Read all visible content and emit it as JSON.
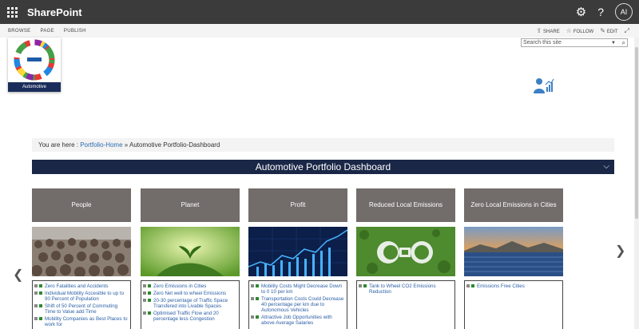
{
  "suitebar": {
    "brand": "SharePoint",
    "avatar_initials": "AI",
    "help_label": "?"
  },
  "ribbon": {
    "tabs": [
      "BROWSE",
      "PAGE",
      "PUBLISH"
    ],
    "actions": {
      "share": "SHARE",
      "follow": "FOLLOW",
      "edit": "EDIT"
    }
  },
  "logo": {
    "label": "Automotive"
  },
  "search": {
    "placeholder": "Search this site"
  },
  "breadcrumb": {
    "prefix": "You are here : ",
    "home": "Portfolio-Home",
    "separator": " » ",
    "current": "Automotive Portfolio-Dashboard"
  },
  "dashboard": {
    "title": "Automotive Portfolio Dashboard"
  },
  "cards": [
    {
      "title": "People",
      "items": [
        "Zero Fatalities and Accidents",
        "Individual Mobility Accesible to up to 90 Percent of Population",
        "Shift of 50 Percent of Commuting Time to Value add Time",
        "Mobility Companies as Best Places to work for"
      ]
    },
    {
      "title": "Planet",
      "items": [
        "Zero Emissions in Cities",
        "Zero Net well to wheel Emissions",
        "20-30 percentage of Traffic Space Transfered into Livable Spaces",
        "Optimised Traffic Flow and 20 percentage less Congestion"
      ]
    },
    {
      "title": "Profit",
      "items": [
        "Mobility Costs Might Decrease Down to 0 10 per km",
        "Transportation Costs Could Decrease 40 percentage per km due to Autonomous Vehicles",
        "Attractive Job Opportunities with above Average Salaries"
      ]
    },
    {
      "title": "Reduced Local Emissions",
      "items": [
        "Tank to Wheel CO2 Emissions Reduction"
      ]
    },
    {
      "title": "Zero Local Emissions in Cities",
      "items": [
        "Emissions Free Cities"
      ]
    }
  ],
  "colors": {
    "suitebar": "#3b3b3b",
    "dashbar": "#1a2747",
    "card_header": "#726c6a",
    "link": "#2b5fa5",
    "bullet_green": "#2c8a2c"
  },
  "icons": [
    "waffle-icon",
    "gear-icon",
    "help-icon",
    "share-icon",
    "star-icon",
    "pencil-icon",
    "expand-icon",
    "search-icon",
    "chevron-down-icon",
    "chevron-left-icon",
    "chevron-right-icon",
    "person-chart-icon"
  ]
}
